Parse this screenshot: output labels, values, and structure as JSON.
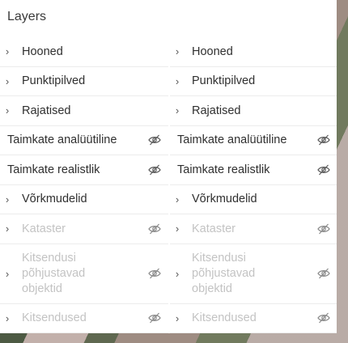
{
  "panel": {
    "title": "Layers"
  },
  "columns": [
    {
      "items": [
        {
          "label": "Hooned",
          "chevron": true,
          "eye": false,
          "disabled": false
        },
        {
          "label": "Punktipilved",
          "chevron": true,
          "eye": false,
          "disabled": false
        },
        {
          "label": "Rajatised",
          "chevron": true,
          "eye": false,
          "disabled": false
        },
        {
          "label": "Taimkate analüütiline",
          "chevron": false,
          "eye": true,
          "disabled": false
        },
        {
          "label": "Taimkate realistlik",
          "chevron": false,
          "eye": true,
          "disabled": false
        },
        {
          "label": "Võrkmudelid",
          "chevron": true,
          "eye": false,
          "disabled": false
        },
        {
          "label": "Kataster",
          "chevron": true,
          "eye": true,
          "disabled": true
        },
        {
          "label": "Kitsendusi põhjustavad objektid",
          "chevron": true,
          "eye": true,
          "disabled": true
        },
        {
          "label": "Kitsendused",
          "chevron": true,
          "eye": true,
          "disabled": true
        }
      ]
    },
    {
      "items": [
        {
          "label": "Hooned",
          "chevron": true,
          "eye": false,
          "disabled": false
        },
        {
          "label": "Punktipilved",
          "chevron": true,
          "eye": false,
          "disabled": false
        },
        {
          "label": "Rajatised",
          "chevron": true,
          "eye": false,
          "disabled": false
        },
        {
          "label": "Taimkate analüütiline",
          "chevron": false,
          "eye": true,
          "disabled": false
        },
        {
          "label": "Taimkate realistlik",
          "chevron": false,
          "eye": true,
          "disabled": false
        },
        {
          "label": "Võrkmudelid",
          "chevron": true,
          "eye": false,
          "disabled": false
        },
        {
          "label": "Kataster",
          "chevron": true,
          "eye": true,
          "disabled": true
        },
        {
          "label": "Kitsendusi põhjustavad objektid",
          "chevron": true,
          "eye": true,
          "disabled": true
        },
        {
          "label": "Kitsendused",
          "chevron": true,
          "eye": true,
          "disabled": true
        }
      ]
    }
  ],
  "icons": {
    "chevron": "chevron-right-icon",
    "visibility": "eye-off-icon"
  },
  "colors": {
    "text": "#2f2f2f",
    "disabled": "#c3c3c3",
    "panel": "#ffffff"
  }
}
